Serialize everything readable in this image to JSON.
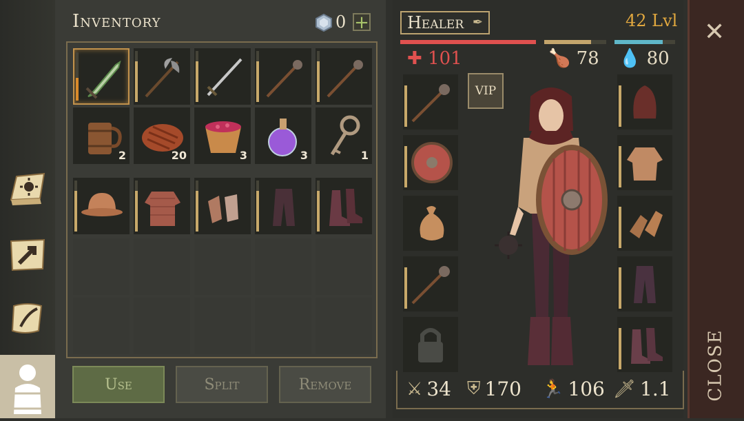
{
  "inventory": {
    "title": "Inventory",
    "gem_count": "0",
    "plus_label": "+",
    "slots": [
      {
        "item": "Crystal Dagger",
        "qty": "",
        "bar": 0.45
      },
      {
        "item": "Halberd",
        "qty": "",
        "bar": 0.8
      },
      {
        "item": "Sword",
        "qty": "",
        "bar": 0.8
      },
      {
        "item": "Spiked Mace",
        "qty": "",
        "bar": 0.8
      },
      {
        "item": "Spiked Mace",
        "qty": "",
        "bar": 0.8
      },
      {
        "item": "Tankard",
        "qty": "2"
      },
      {
        "item": "Steak",
        "qty": "20"
      },
      {
        "item": "Berry Bowl",
        "qty": "3"
      },
      {
        "item": "Mana Potion",
        "qty": "3"
      },
      {
        "item": "Ornate Key",
        "qty": "1"
      },
      {
        "item": "Leather Helmet",
        "qty": "",
        "bar": 0.8
      },
      {
        "item": "Chainmail Shirt",
        "qty": "",
        "bar": 0.8
      },
      {
        "item": "Chain Gloves",
        "qty": "",
        "bar": 0.8
      },
      {
        "item": "Leather Pants",
        "qty": "",
        "bar": 0.8
      },
      {
        "item": "Leather Boots",
        "qty": "",
        "bar": 0.8
      }
    ]
  },
  "buttons": {
    "use": "Use",
    "split": "Split",
    "remove": "Remove"
  },
  "character": {
    "class_name": "Healer",
    "level": "42 Lvl",
    "health": "101",
    "hunger": "78",
    "thirst": "80",
    "health_fill": 1.0,
    "hunger_fill": 0.75,
    "thirst_fill": 0.8,
    "vip_label": "VIP",
    "damage": "34",
    "armor": "170",
    "speed": "106",
    "attack_speed": "1.1",
    "colors": {
      "health": "#e0514f",
      "hunger": "#c4a56c",
      "thirst": "#5fb7c9",
      "level": "#e1a83f"
    }
  },
  "close": {
    "label": "CLOSE"
  },
  "equipment_left": [
    "Spiked Mace",
    "Round Shield",
    "Pouch",
    "Spiked Mace",
    "Locked Slot"
  ],
  "equipment_right": [
    "Hood",
    "Gambeson",
    "Leather Gloves",
    "Pants",
    "Boots"
  ]
}
